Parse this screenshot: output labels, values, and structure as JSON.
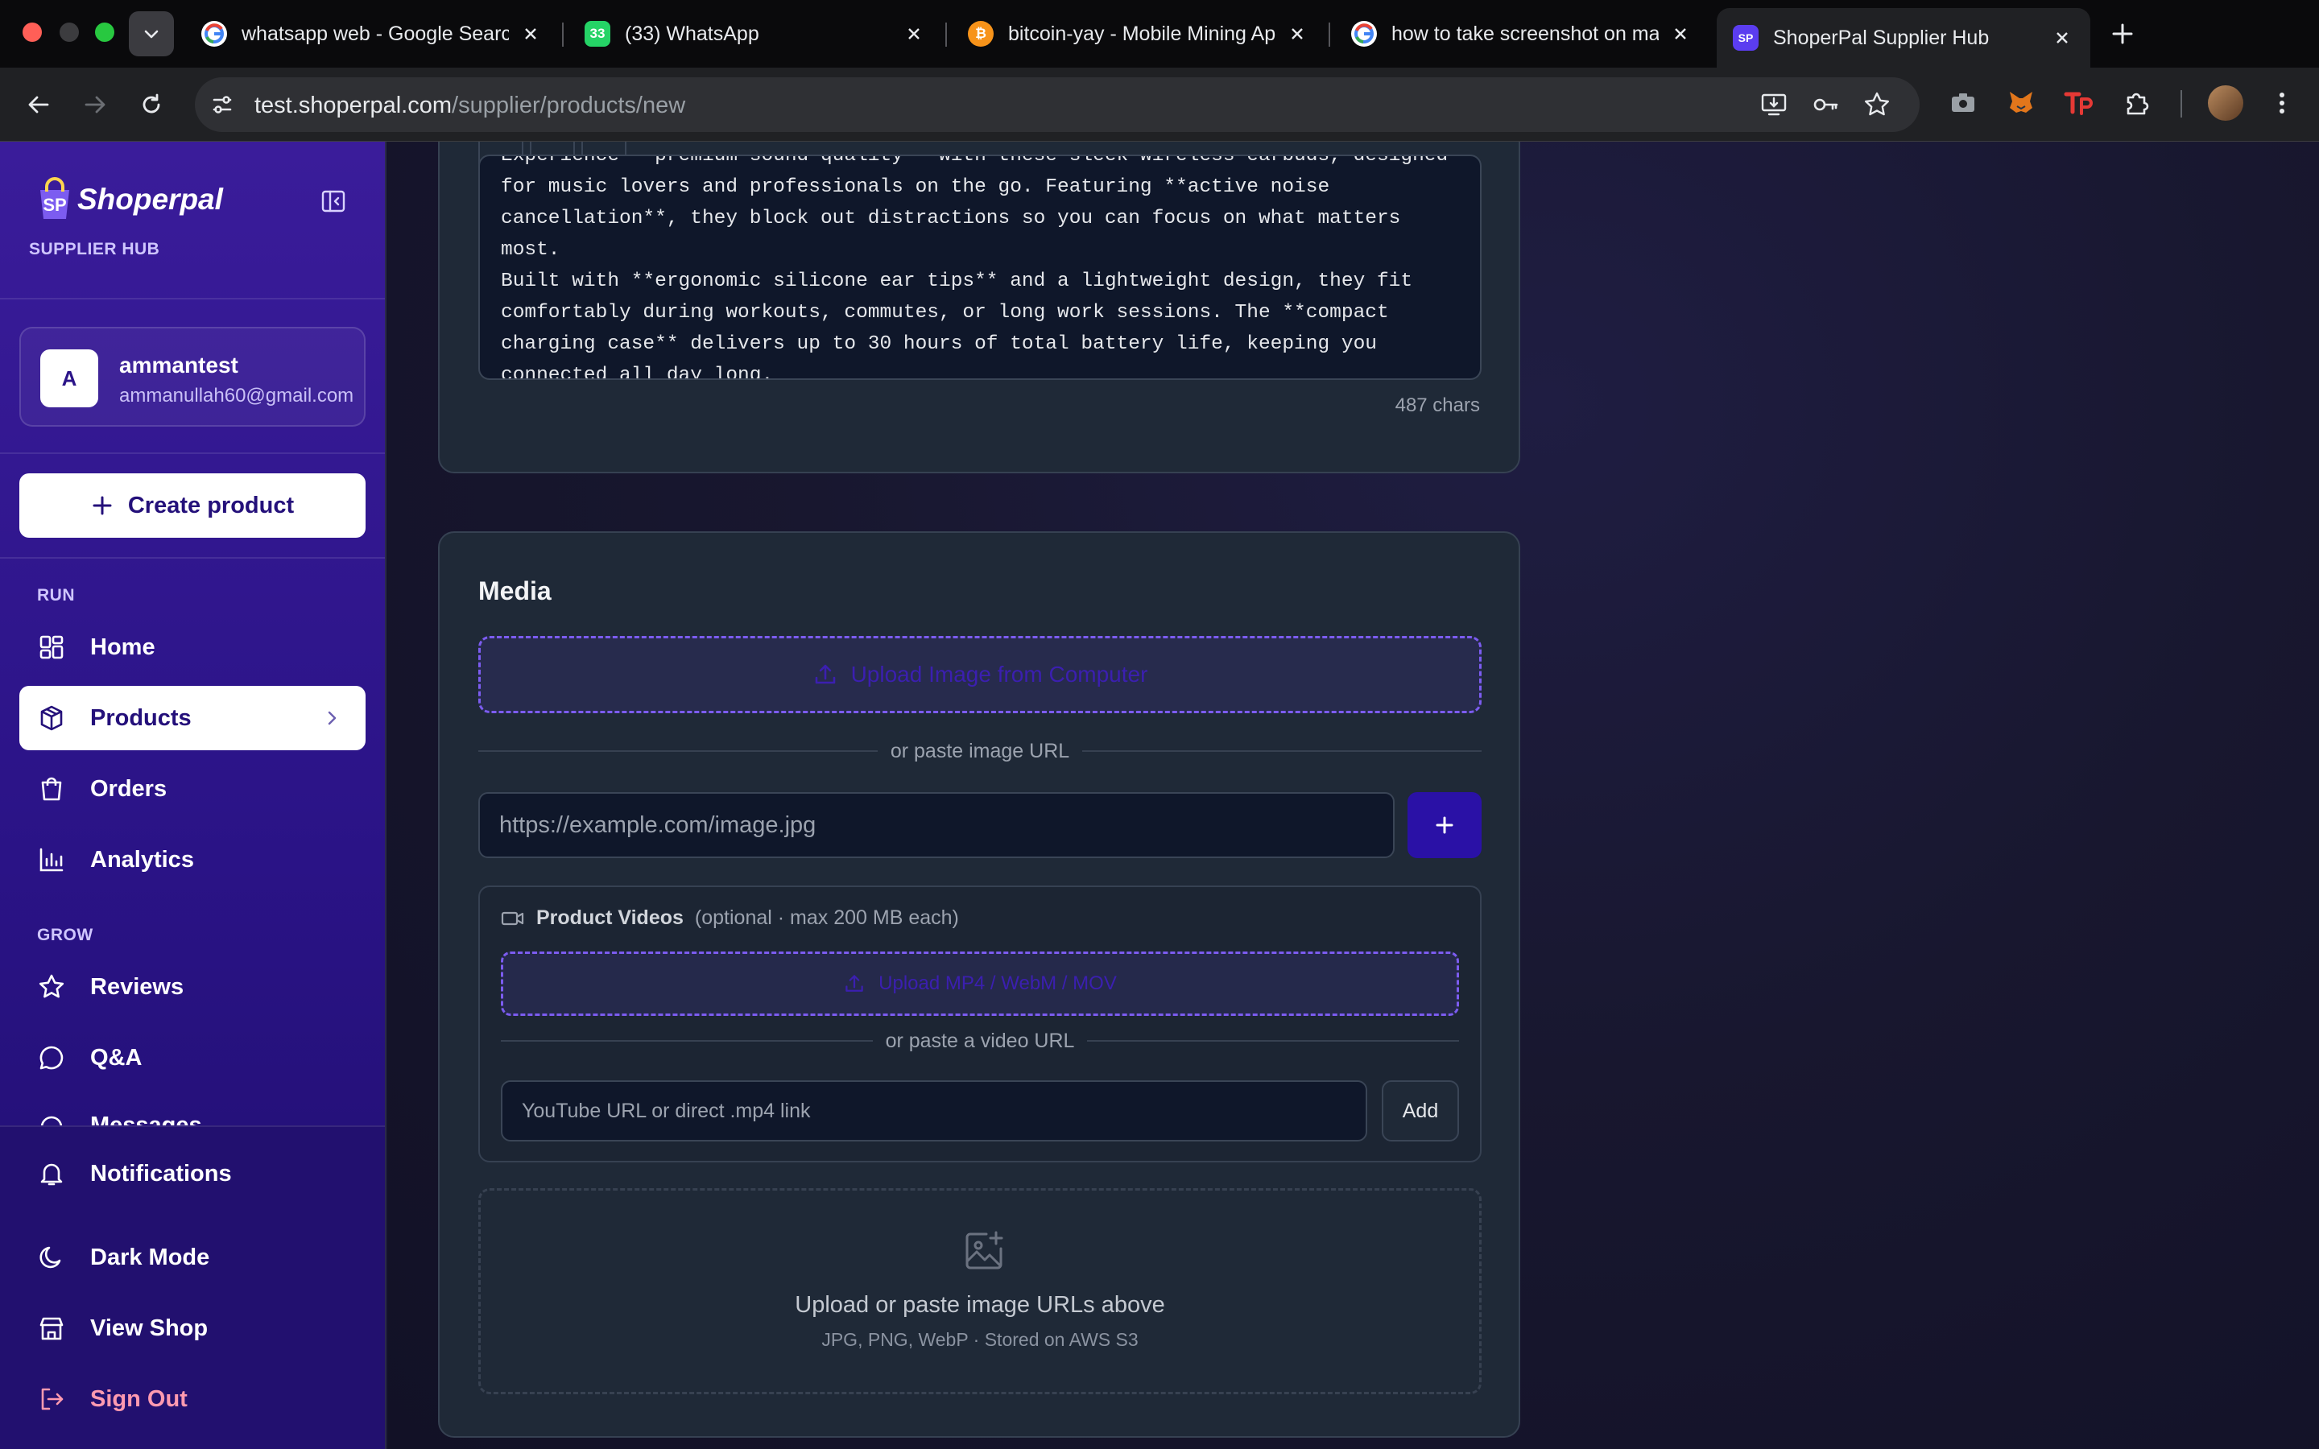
{
  "browser": {
    "tabs": [
      {
        "title": "whatsapp web - Google Search",
        "favicon": "google-g-icon"
      },
      {
        "title": "(33) WhatsApp",
        "favicon": "whatsapp-icon",
        "badge": "33"
      },
      {
        "title": "bitcoin-yay - Mobile Mining App",
        "favicon": "bitcoin-icon"
      },
      {
        "title": "how to take screenshot on mac",
        "favicon": "google-g-icon"
      },
      {
        "title": "ShoperPal Supplier Hub",
        "favicon": "shoperpal-icon",
        "active": true
      }
    ],
    "url_domain": "test.shoperpal.com",
    "url_path": "/supplier/products/new"
  },
  "sidebar": {
    "brand": "Shoperpal",
    "brand_mark": "SP",
    "hub_label": "SUPPLIER HUB",
    "user": {
      "initial": "A",
      "name": "ammantest",
      "email": "ammanullah60@gmail.com"
    },
    "create_label": "Create product",
    "sections": {
      "run": "RUN",
      "grow": "GROW"
    },
    "items": {
      "home": "Home",
      "products": "Products",
      "orders": "Orders",
      "analytics": "Analytics",
      "reviews": "Reviews",
      "qa": "Q&A",
      "messages": "Messages"
    },
    "bottom": {
      "notifications": "Notifications",
      "dark_mode": "Dark Mode",
      "view_shop": "View Shop",
      "sign_out": "Sign Out"
    },
    "colors": {
      "active_text": "#24107a",
      "sign_out": "#ff9ab0"
    }
  },
  "description": {
    "text": "Experience **premium sound quality** with these sleek wireless earbuds, designed\nfor music lovers and professionals on the go. Featuring **active noise\ncancellation**, they block out distractions so you can focus on what matters most.\nBuilt with **ergonomic silicone ear tips** and a lightweight design, they fit\ncomfortably during workouts, commutes, or long work sessions. The **compact\ncharging case** delivers up to 30 hours of total battery life, keeping you\nconnected all day long.",
    "char_count": "487 chars"
  },
  "media": {
    "title": "Media",
    "upload_image_label": "Upload Image from Computer",
    "or_paste_image": "or paste image URL",
    "image_url_placeholder": "https://example.com/image.jpg",
    "videos": {
      "title": "Product Videos",
      "hint": "(optional · max 200 MB each)",
      "upload_label": "Upload MP4 / WebM / MOV",
      "or_paste_video": "or paste a video URL",
      "video_url_placeholder": "YouTube URL or direct .mp4 link",
      "add_label": "Add"
    },
    "empty": {
      "title": "Upload or paste image URLs above",
      "subtitle": "JPG, PNG, WebP · Stored on AWS S3"
    },
    "colors": {
      "accent": "#2a11a6",
      "dashed_border": "#7c5cf0"
    }
  }
}
